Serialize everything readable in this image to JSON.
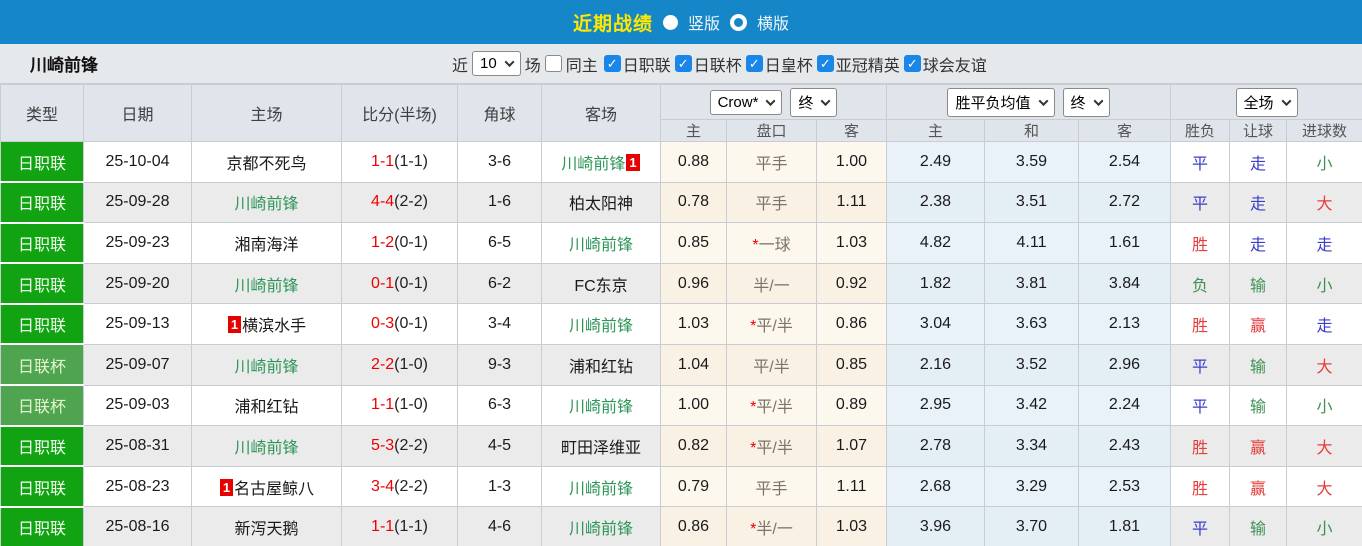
{
  "topbar": {
    "title": "近期战绩",
    "radio_vertical": "竖版",
    "radio_horizontal": "横版"
  },
  "filterbar": {
    "team": "川崎前锋",
    "recent_label": "近",
    "recent_value": "10",
    "games_label": "场",
    "same_home_label": "同主",
    "leagues": [
      "日职联",
      "日联杯",
      "日皇杯",
      "亚冠精英",
      "球会友谊"
    ]
  },
  "table": {
    "columns_left": [
      "类型",
      "日期",
      "主场",
      "比分(半场)",
      "角球",
      "客场"
    ],
    "group1": {
      "select1": "Crow*",
      "select2": "终",
      "subcols": [
        "主",
        "盘口",
        "客"
      ]
    },
    "group2": {
      "select1": "胜平负均值",
      "select2": "终",
      "subcols": [
        "主",
        "和",
        "客"
      ]
    },
    "group3": {
      "select1": "全场",
      "subcols": [
        "胜负",
        "让球",
        "进球数"
      ]
    },
    "rows": [
      {
        "league": "日职联",
        "cup": false,
        "date": "25-10-04",
        "home": {
          "name": "京都不死鸟",
          "green": false,
          "badge": "",
          "badge_pos": ""
        },
        "score": "1-1",
        "half": "(1-1)",
        "corner": "3-6",
        "away": {
          "name": "川崎前锋",
          "green": true,
          "badge": "1",
          "badge_pos": "after"
        },
        "odds": {
          "home": "0.88",
          "star": false,
          "handicap": "平手",
          "away": "1.00"
        },
        "avg": {
          "home": "2.49",
          "draw": "3.59",
          "away": "2.54"
        },
        "results": [
          {
            "text": "平",
            "color": "b"
          },
          {
            "text": "走",
            "color": "b"
          },
          {
            "text": "小",
            "color": "g"
          }
        ]
      },
      {
        "league": "日职联",
        "cup": false,
        "date": "25-09-28",
        "home": {
          "name": "川崎前锋",
          "green": true,
          "badge": "",
          "badge_pos": ""
        },
        "score": "4-4",
        "half": "(2-2)",
        "corner": "1-6",
        "away": {
          "name": "柏太阳神",
          "green": false,
          "badge": "",
          "badge_pos": ""
        },
        "odds": {
          "home": "0.78",
          "star": false,
          "handicap": "平手",
          "away": "1.11"
        },
        "avg": {
          "home": "2.38",
          "draw": "3.51",
          "away": "2.72"
        },
        "results": [
          {
            "text": "平",
            "color": "b"
          },
          {
            "text": "走",
            "color": "b"
          },
          {
            "text": "大",
            "color": "r"
          }
        ]
      },
      {
        "league": "日职联",
        "cup": false,
        "date": "25-09-23",
        "home": {
          "name": "湘南海洋",
          "green": false,
          "badge": "",
          "badge_pos": ""
        },
        "score": "1-2",
        "half": "(0-1)",
        "corner": "6-5",
        "away": {
          "name": "川崎前锋",
          "green": true,
          "badge": "",
          "badge_pos": ""
        },
        "odds": {
          "home": "0.85",
          "star": true,
          "handicap": "一球",
          "away": "1.03"
        },
        "avg": {
          "home": "4.82",
          "draw": "4.11",
          "away": "1.61"
        },
        "results": [
          {
            "text": "胜",
            "color": "r"
          },
          {
            "text": "走",
            "color": "b"
          },
          {
            "text": "走",
            "color": "b"
          }
        ]
      },
      {
        "league": "日职联",
        "cup": false,
        "date": "25-09-20",
        "home": {
          "name": "川崎前锋",
          "green": true,
          "badge": "",
          "badge_pos": ""
        },
        "score": "0-1",
        "half": "(0-1)",
        "corner": "6-2",
        "away": {
          "name": "FC东京",
          "green": false,
          "badge": "",
          "badge_pos": ""
        },
        "odds": {
          "home": "0.96",
          "star": false,
          "handicap": "半/一",
          "away": "0.92"
        },
        "avg": {
          "home": "1.82",
          "draw": "3.81",
          "away": "3.84"
        },
        "results": [
          {
            "text": "负",
            "color": "g"
          },
          {
            "text": "输",
            "color": "g"
          },
          {
            "text": "小",
            "color": "g"
          }
        ]
      },
      {
        "league": "日职联",
        "cup": false,
        "date": "25-09-13",
        "home": {
          "name": "横滨水手",
          "green": false,
          "badge": "1",
          "badge_pos": "before"
        },
        "score": "0-3",
        "half": "(0-1)",
        "corner": "3-4",
        "away": {
          "name": "川崎前锋",
          "green": true,
          "badge": "",
          "badge_pos": ""
        },
        "odds": {
          "home": "1.03",
          "star": true,
          "handicap": "平/半",
          "away": "0.86"
        },
        "avg": {
          "home": "3.04",
          "draw": "3.63",
          "away": "2.13"
        },
        "results": [
          {
            "text": "胜",
            "color": "r"
          },
          {
            "text": "赢",
            "color": "r"
          },
          {
            "text": "走",
            "color": "b"
          }
        ]
      },
      {
        "league": "日联杯",
        "cup": true,
        "date": "25-09-07",
        "home": {
          "name": "川崎前锋",
          "green": true,
          "badge": "",
          "badge_pos": ""
        },
        "score": "2-2",
        "half": "(1-0)",
        "corner": "9-3",
        "away": {
          "name": "浦和红钻",
          "green": false,
          "badge": "",
          "badge_pos": ""
        },
        "odds": {
          "home": "1.04",
          "star": false,
          "handicap": "平/半",
          "away": "0.85"
        },
        "avg": {
          "home": "2.16",
          "draw": "3.52",
          "away": "2.96"
        },
        "results": [
          {
            "text": "平",
            "color": "b"
          },
          {
            "text": "输",
            "color": "g"
          },
          {
            "text": "大",
            "color": "r"
          }
        ]
      },
      {
        "league": "日联杯",
        "cup": true,
        "date": "25-09-03",
        "home": {
          "name": "浦和红钻",
          "green": false,
          "badge": "",
          "badge_pos": ""
        },
        "score": "1-1",
        "half": "(1-0)",
        "corner": "6-3",
        "away": {
          "name": "川崎前锋",
          "green": true,
          "badge": "",
          "badge_pos": ""
        },
        "odds": {
          "home": "1.00",
          "star": true,
          "handicap": "平/半",
          "away": "0.89"
        },
        "avg": {
          "home": "2.95",
          "draw": "3.42",
          "away": "2.24"
        },
        "results": [
          {
            "text": "平",
            "color": "b"
          },
          {
            "text": "输",
            "color": "g"
          },
          {
            "text": "小",
            "color": "g"
          }
        ]
      },
      {
        "league": "日职联",
        "cup": false,
        "date": "25-08-31",
        "home": {
          "name": "川崎前锋",
          "green": true,
          "badge": "",
          "badge_pos": ""
        },
        "score": "5-3",
        "half": "(2-2)",
        "corner": "4-5",
        "away": {
          "name": "町田泽维亚",
          "green": false,
          "badge": "",
          "badge_pos": ""
        },
        "odds": {
          "home": "0.82",
          "star": true,
          "handicap": "平/半",
          "away": "1.07"
        },
        "avg": {
          "home": "2.78",
          "draw": "3.34",
          "away": "2.43"
        },
        "results": [
          {
            "text": "胜",
            "color": "r"
          },
          {
            "text": "赢",
            "color": "r"
          },
          {
            "text": "大",
            "color": "r"
          }
        ]
      },
      {
        "league": "日职联",
        "cup": false,
        "date": "25-08-23",
        "home": {
          "name": "名古屋鲸八",
          "green": false,
          "badge": "1",
          "badge_pos": "before"
        },
        "score": "3-4",
        "half": "(2-2)",
        "corner": "1-3",
        "away": {
          "name": "川崎前锋",
          "green": true,
          "badge": "",
          "badge_pos": ""
        },
        "odds": {
          "home": "0.79",
          "star": false,
          "handicap": "平手",
          "away": "1.11"
        },
        "avg": {
          "home": "2.68",
          "draw": "3.29",
          "away": "2.53"
        },
        "results": [
          {
            "text": "胜",
            "color": "r"
          },
          {
            "text": "赢",
            "color": "r"
          },
          {
            "text": "大",
            "color": "r"
          }
        ]
      },
      {
        "league": "日职联",
        "cup": false,
        "date": "25-08-16",
        "home": {
          "name": "新泻天鹅",
          "green": false,
          "badge": "",
          "badge_pos": ""
        },
        "score": "1-1",
        "half": "(1-1)",
        "corner": "4-6",
        "away": {
          "name": "川崎前锋",
          "green": true,
          "badge": "",
          "badge_pos": ""
        },
        "odds": {
          "home": "0.86",
          "star": true,
          "handicap": "半/一",
          "away": "1.03"
        },
        "avg": {
          "home": "3.96",
          "draw": "3.70",
          "away": "1.81"
        },
        "results": [
          {
            "text": "平",
            "color": "b"
          },
          {
            "text": "输",
            "color": "g"
          },
          {
            "text": "小",
            "color": "g"
          }
        ]
      }
    ]
  },
  "colors": {
    "topbar_blue": "#1586c8",
    "title_yellow": "#ffe800",
    "league_green": "#12a312",
    "cup_green": "#4fa44f",
    "team_green": "#2e9658",
    "score_red": "#ee0000",
    "result_red": "#e63c3c",
    "result_green": "#3f9153",
    "result_blue": "#3c3ccc",
    "checkbox_blue": "#1a86e8"
  }
}
